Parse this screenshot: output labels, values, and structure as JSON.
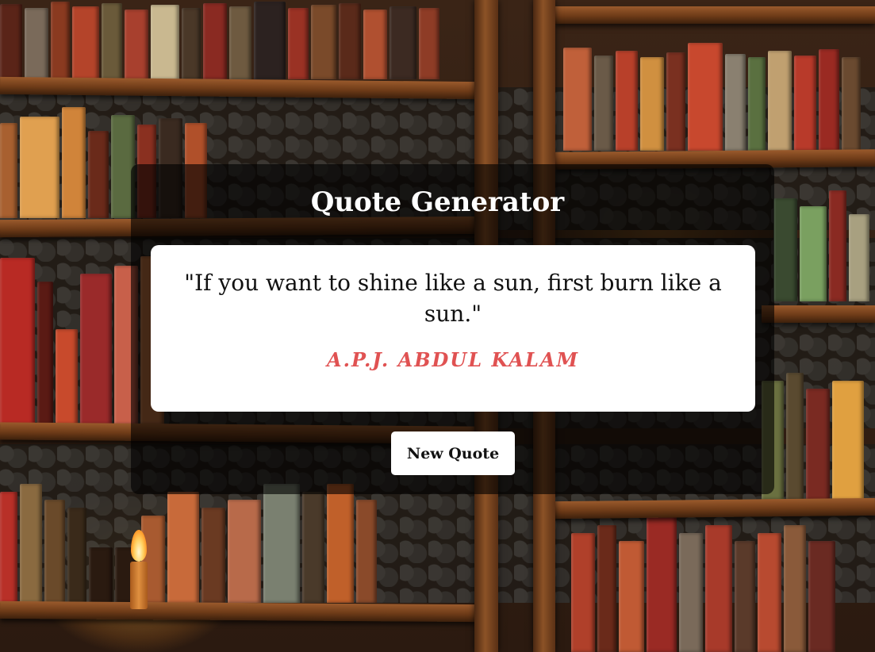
{
  "app": {
    "title": "Quote Generator"
  },
  "quote": {
    "text": "\"If you want to shine like a sun, first burn like a sun.\"",
    "author": "A.P.J. ABDUL KALAM"
  },
  "actions": {
    "new_quote_label": "New Quote"
  },
  "colors": {
    "author": "#e05252",
    "panel_overlay": "rgba(0,0,0,0.62)",
    "card": "#ffffff",
    "button": "#ffffff"
  },
  "background": {
    "icon": "bookshelf-image"
  }
}
